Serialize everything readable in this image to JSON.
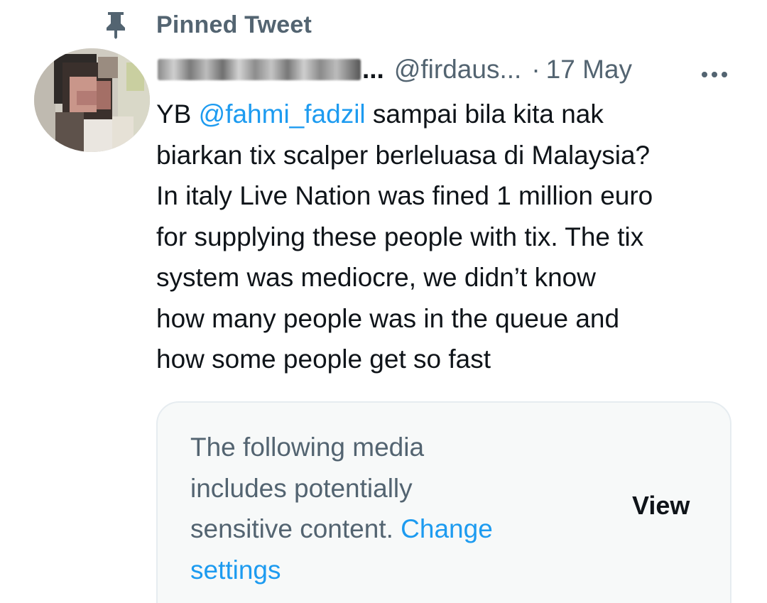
{
  "pinned": {
    "label": "Pinned Tweet",
    "icon": "pin-icon"
  },
  "author": {
    "display_name_suffix": "...",
    "handle": "@firdaus...",
    "separator": "·",
    "date": "17 May",
    "avatar_icon": "avatar-image",
    "more_icon": "more-icon"
  },
  "tweet": {
    "lines": [
      {
        "prefix": "YB ",
        "mention": "@fahmi_fadzil",
        "suffix": " sampai bila kita nak"
      },
      {
        "text": "biarkan tix scalper berleluasa di Malaysia?"
      },
      {
        "text": "In italy Live Nation was fined 1 million euro"
      },
      {
        "text": "for supplying these people with tix. The tix"
      },
      {
        "text": "system was mediocre, we didn’t know"
      },
      {
        "text": "how many people was in the queue and"
      },
      {
        "text": "how some people get so fast"
      }
    ]
  },
  "media_warning": {
    "line1": "The following media",
    "line2": "includes potentially",
    "line3": "sensitive content. ",
    "link_part1": "Change",
    "link_part2": "settings",
    "view_label": "View"
  },
  "colors": {
    "text_primary": "#0f1419",
    "text_secondary": "#536471",
    "link": "#1d9bf0",
    "card_bg": "#f7f9f9",
    "card_border": "#e6ecf0"
  }
}
